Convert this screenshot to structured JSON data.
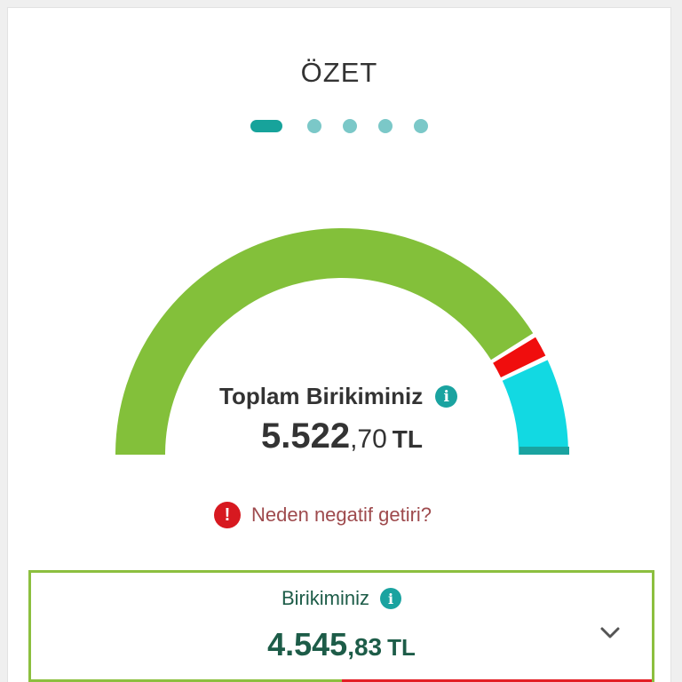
{
  "page": {
    "title": "ÖZET"
  },
  "pager": {
    "count": 5,
    "active_index": 0
  },
  "gauge": {
    "segments": [
      {
        "name": "birikim",
        "color": "#83c03a",
        "value": 4545.83
      },
      {
        "name": "negatif-getiri",
        "color": "#f00d0d",
        "value": 200
      },
      {
        "name": "katki",
        "color": "#12d9e2",
        "value": 776.87
      }
    ],
    "base_color": "#1aa3a0"
  },
  "total": {
    "label": "Toplam Birikiminiz",
    "integer": "5.522",
    "decimal": ",70",
    "currency": "TL"
  },
  "warning": {
    "text": "Neden negatif getiri?",
    "icon_text": "!"
  },
  "savings": {
    "label": "Birikiminiz",
    "integer": "4.545",
    "decimal": ",83",
    "currency": "TL"
  },
  "icons": {
    "info": "i",
    "chevron": "chevron-down-icon"
  },
  "colors": {
    "accent": "#1aa3a0",
    "positive": "#83c03a",
    "negative": "#e31e24",
    "text_dark": "#333333",
    "savings_text": "#1d5c48"
  }
}
